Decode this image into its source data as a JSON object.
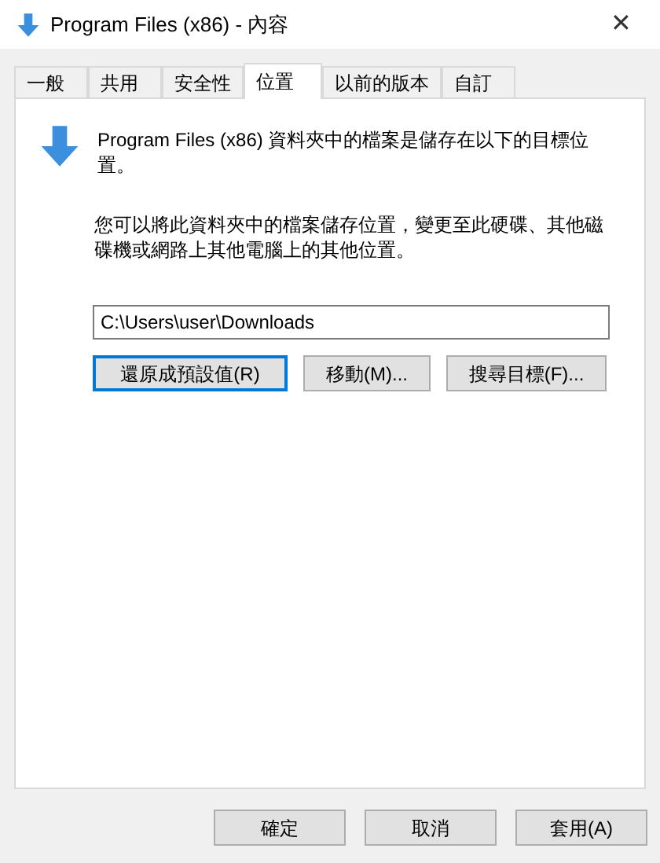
{
  "window": {
    "title": "Program Files (x86) - 內容",
    "close": "✕"
  },
  "tabs": [
    {
      "label": "一般",
      "selected": false
    },
    {
      "label": "共用",
      "selected": false
    },
    {
      "label": "安全性",
      "selected": false
    },
    {
      "label": "位置",
      "selected": true
    },
    {
      "label": "以前的版本",
      "selected": false
    },
    {
      "label": "自訂",
      "selected": false
    }
  ],
  "location": {
    "description": "Program Files (x86) 資料夾中的檔案是儲存在以下的目標位置。",
    "hint": "您可以將此資料夾中的檔案儲存位置，變更至此硬碟、其他磁碟機或網路上其他電腦上的其他位置。",
    "path": "C:\\Users\\user\\Downloads",
    "buttons": [
      {
        "label": "還原成預設值(R)",
        "default": true
      },
      {
        "label": "移動(M)...",
        "default": false
      },
      {
        "label": "搜尋目標(F)...",
        "default": false
      }
    ]
  },
  "footer_buttons": [
    "確定",
    "取消",
    "套用(A)"
  ]
}
